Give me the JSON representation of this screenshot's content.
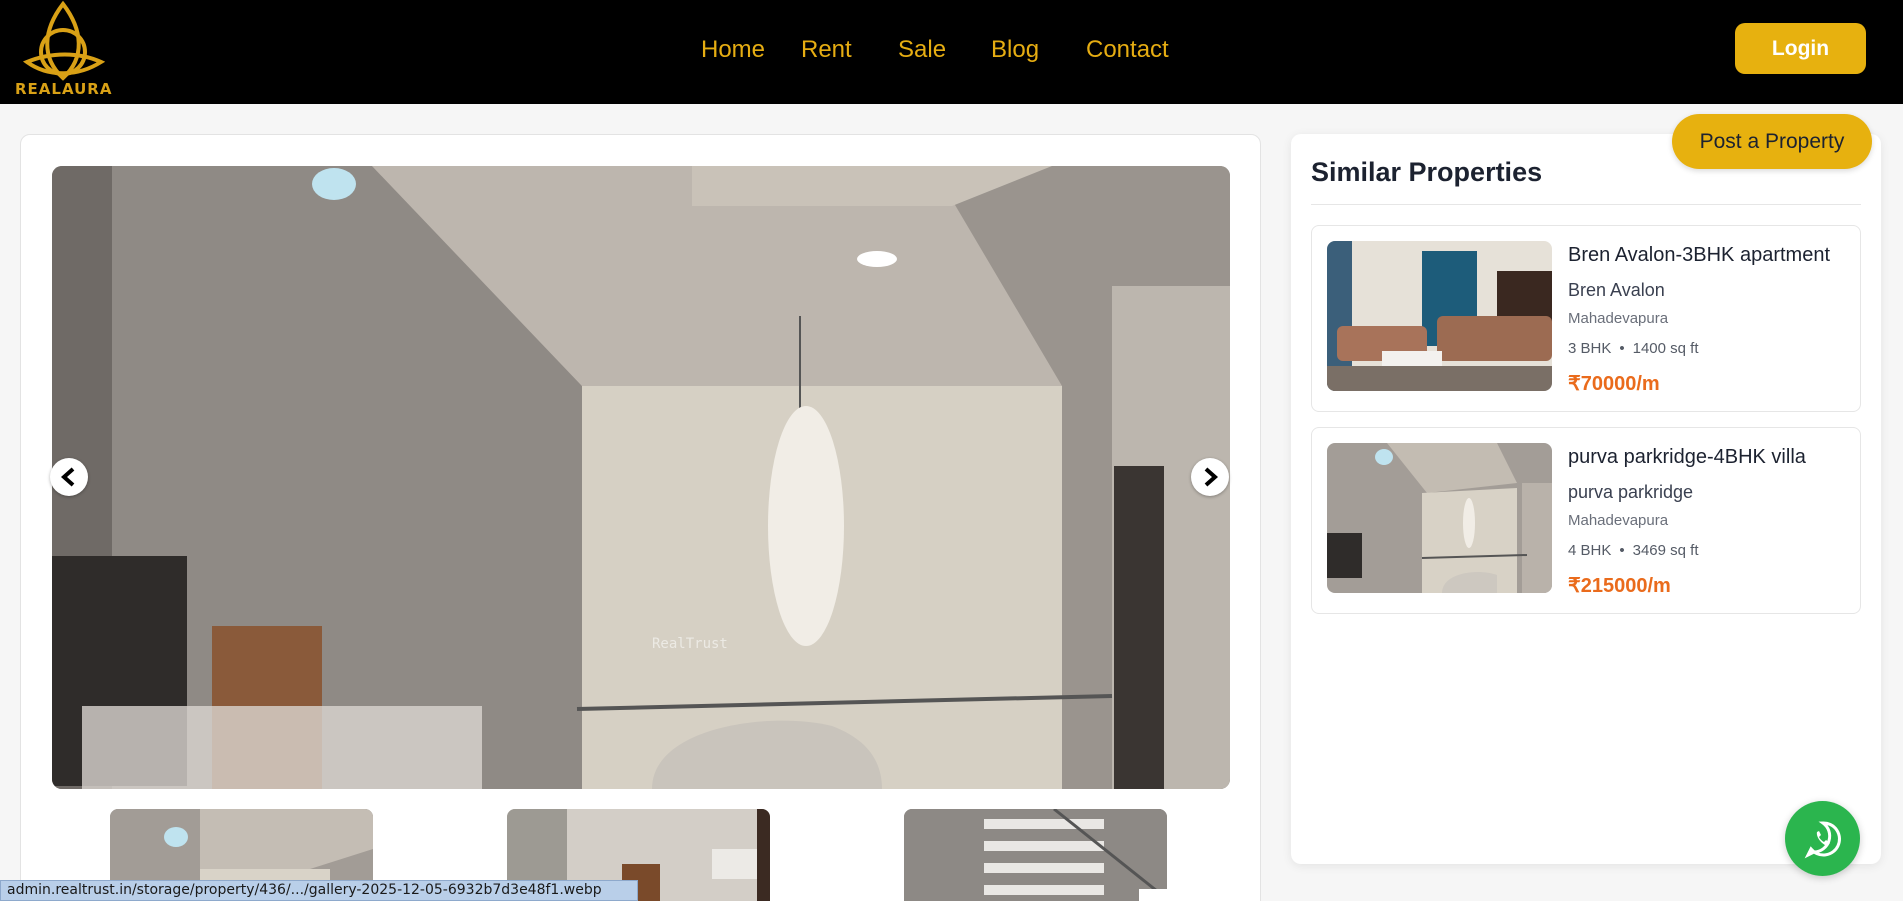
{
  "brand": {
    "name": "REALAURA",
    "accent": "#e7b10f",
    "header_bg": "#000000"
  },
  "nav": {
    "items": [
      "Home",
      "Rent",
      "Sale",
      "Blog",
      "Contact"
    ],
    "login_label": "Login"
  },
  "gallery": {
    "watermark": "RealTrust",
    "prev_icon": "chevron-left-icon",
    "next_icon": "chevron-right-icon"
  },
  "sidebar": {
    "title": "Similar Properties",
    "post_label": "Post a Property",
    "items": [
      {
        "title": "Bren Avalon-3BHK apartment",
        "project": "Bren Avalon",
        "location": "Mahadevapura",
        "bhk": "3 BHK",
        "area": "1400 sq ft",
        "price": "₹70000/m"
      },
      {
        "title": "purva parkridge-4BHK villa",
        "project": "purva parkridge",
        "location": "Mahadevapura",
        "bhk": "4 BHK",
        "area": "3469 sq ft",
        "price": "₹215000/m"
      }
    ]
  },
  "whatsapp": {
    "icon": "whatsapp-icon",
    "color": "#2bb54e"
  },
  "status_bar": {
    "url": "admin.realtrust.in/storage/property/436/.../gallery-2025-12-05-6932b7d3e48f1.webp"
  },
  "colors": {
    "price": "#ea6b1c"
  }
}
